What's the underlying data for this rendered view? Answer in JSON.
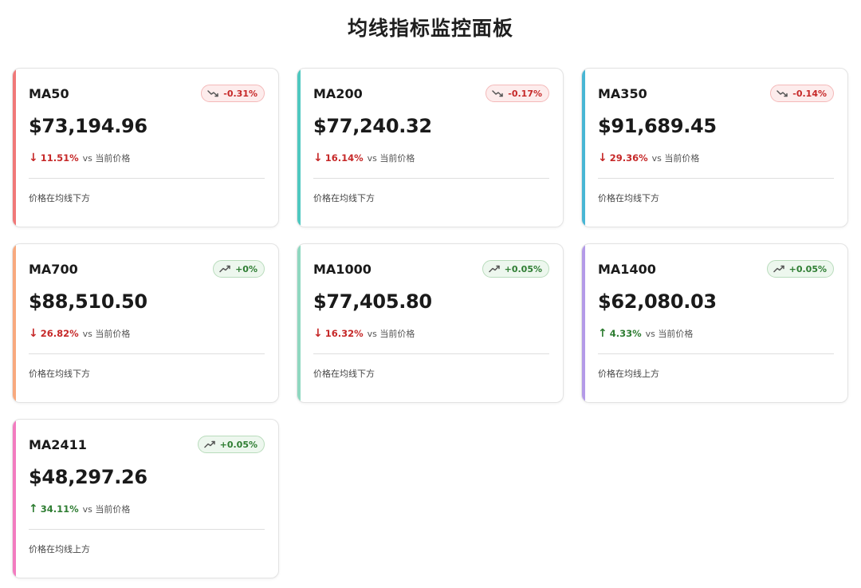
{
  "header": {
    "title": "均线指标监控面板"
  },
  "vs_label": "vs 当前价格",
  "cards": [
    {
      "name": "MA50",
      "value": "$73,194.96",
      "change": "-0.31%",
      "change_dir": "down",
      "diff_arrow": "↓",
      "diff_pct": "11.51%",
      "diff_dir": "down",
      "status": "价格在均线下方",
      "accent": "#f07878"
    },
    {
      "name": "MA200",
      "value": "$77,240.32",
      "change": "-0.17%",
      "change_dir": "down",
      "diff_arrow": "↓",
      "diff_pct": "16.14%",
      "diff_dir": "down",
      "status": "价格在均线下方",
      "accent": "#4ec8c0"
    },
    {
      "name": "MA350",
      "value": "$91,689.45",
      "change": "-0.14%",
      "change_dir": "down",
      "diff_arrow": "↓",
      "diff_pct": "29.36%",
      "diff_dir": "down",
      "status": "价格在均线下方",
      "accent": "#48b6d4"
    },
    {
      "name": "MA700",
      "value": "$88,510.50",
      "change": "+0%",
      "change_dir": "up",
      "diff_arrow": "↓",
      "diff_pct": "26.82%",
      "diff_dir": "down",
      "status": "价格在均线下方",
      "accent": "#f8a97e"
    },
    {
      "name": "MA1000",
      "value": "$77,405.80",
      "change": "+0.05%",
      "change_dir": "up",
      "diff_arrow": "↓",
      "diff_pct": "16.32%",
      "diff_dir": "down",
      "status": "价格在均线下方",
      "accent": "#8fd8c0"
    },
    {
      "name": "MA1400",
      "value": "$62,080.03",
      "change": "+0.05%",
      "change_dir": "up",
      "diff_arrow": "↑",
      "diff_pct": "4.33%",
      "diff_dir": "up",
      "status": "价格在均线上方",
      "accent": "#b49ae8"
    },
    {
      "name": "MA2411",
      "value": "$48,297.26",
      "change": "+0.05%",
      "change_dir": "up",
      "diff_arrow": "↑",
      "diff_pct": "34.11%",
      "diff_dir": "up",
      "status": "价格在均线上方",
      "accent": "#f27cc0"
    }
  ],
  "icons": {
    "down": "trending-down-icon",
    "up": "trending-up-icon"
  },
  "colors": {
    "down": "#c62828",
    "up": "#2e7d32"
  }
}
